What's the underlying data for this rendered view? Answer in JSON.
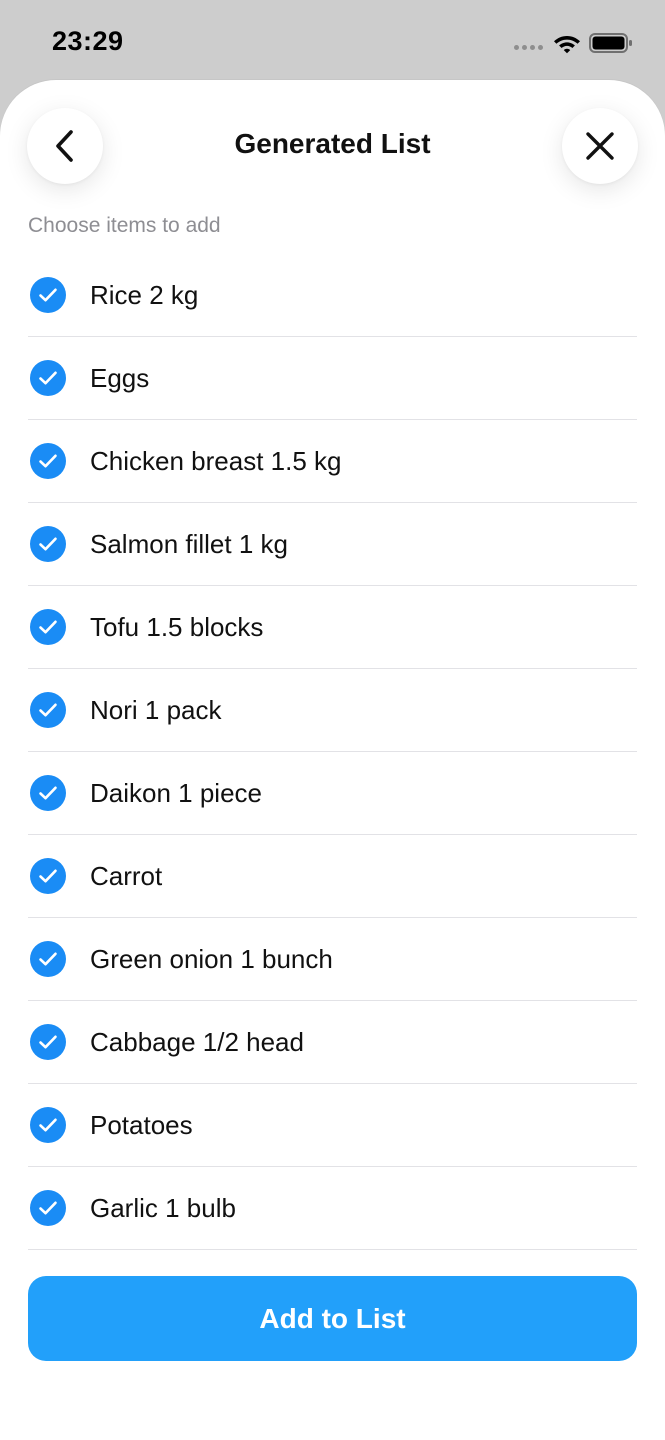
{
  "status": {
    "time": "23:29"
  },
  "header": {
    "title": "Generated List",
    "back_icon": "chevron-left-icon",
    "close_icon": "close-icon"
  },
  "subtitle": "Choose items to add",
  "items": [
    {
      "label": "Rice 2 kg",
      "checked": true
    },
    {
      "label": "Eggs",
      "checked": true
    },
    {
      "label": "Chicken breast 1.5 kg",
      "checked": true
    },
    {
      "label": "Salmon fillet 1 kg",
      "checked": true
    },
    {
      "label": "Tofu 1.5 blocks",
      "checked": true
    },
    {
      "label": "Nori 1 pack",
      "checked": true
    },
    {
      "label": "Daikon 1 piece",
      "checked": true
    },
    {
      "label": "Carrot",
      "checked": true
    },
    {
      "label": "Green onion 1 bunch",
      "checked": true
    },
    {
      "label": "Cabbage 1/2 head",
      "checked": true
    },
    {
      "label": "Potatoes",
      "checked": true
    },
    {
      "label": "Garlic 1 bulb",
      "checked": true
    }
  ],
  "add_button_label": "Add to List",
  "colors": {
    "accent": "#22a0fa",
    "check": "#1a8cf5",
    "background": "#cdcdcd"
  }
}
